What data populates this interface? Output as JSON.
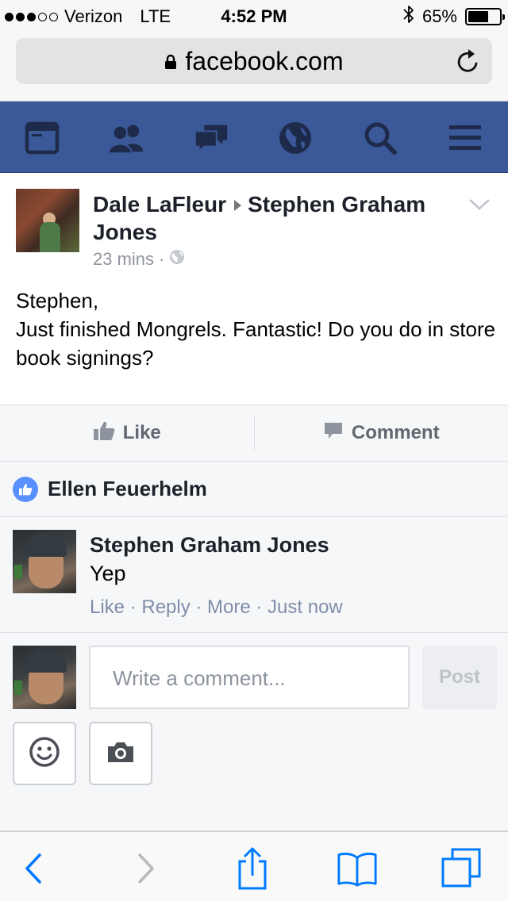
{
  "status_bar": {
    "carrier": "Verizon",
    "network": "LTE",
    "time": "4:52 PM",
    "battery": "65%",
    "battery_level": 0.65,
    "signal_bars": 3,
    "signal_total": 5
  },
  "browser": {
    "url": "facebook.com"
  },
  "fb_nav": {
    "items": [
      "news-feed-icon",
      "friends-icon",
      "messages-icon",
      "notifications-globe-icon",
      "search-icon",
      "menu-icon"
    ]
  },
  "post": {
    "author": "Dale LaFleur",
    "target": "Stephen Graham Jones",
    "time": "23 mins",
    "separator": "·",
    "body_lines": [
      "Stephen,",
      "Just finished Mongrels. Fantastic! Do you do in store book signings?"
    ]
  },
  "actions": {
    "like": "Like",
    "comment": "Comment"
  },
  "likes": {
    "names": "Ellen Feuerhelm"
  },
  "comment": {
    "author": "Stephen Graham Jones",
    "text": "Yep",
    "meta": "Like · Reply · More · Just now"
  },
  "compose": {
    "placeholder": "Write a comment...",
    "post_label": "Post"
  },
  "colors": {
    "fb_blue": "#3b5998",
    "ios_blue": "#007aff",
    "like_badge": "#5890ff"
  }
}
